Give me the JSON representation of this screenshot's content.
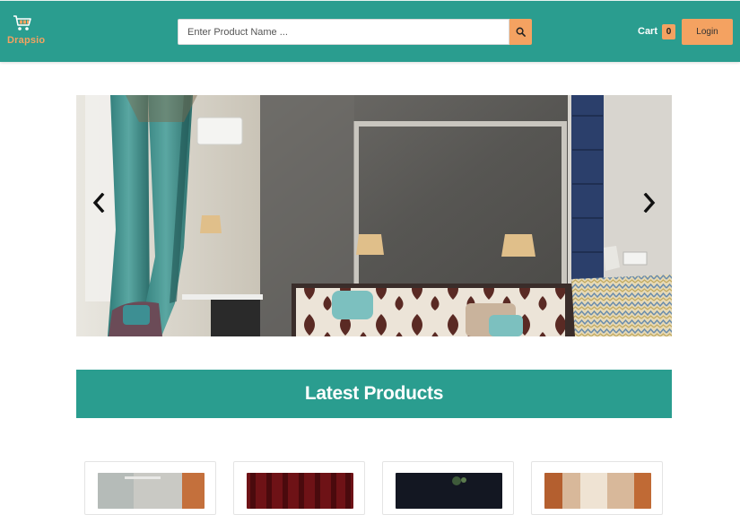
{
  "header": {
    "logo_text": "Drapsio",
    "logo_icon": "shopping-cart-icon",
    "search": {
      "placeholder": "Enter Product Name ...",
      "value": "",
      "button_icon": "search-icon"
    },
    "cart": {
      "label": "Cart",
      "count": "0"
    },
    "login_label": "Login"
  },
  "carousel": {
    "prev_icon": "chevron-left-icon",
    "next_icon": "chevron-right-icon",
    "slide_alt": "Bedroom with teal curtains, stone wall and patterned headboard"
  },
  "section": {
    "title": "Latest Products"
  },
  "products": [
    {
      "image_alt": "Room with orange curtain",
      "thumb_color": "#c9c9c4"
    },
    {
      "image_alt": "Red velvet curtain",
      "thumb_color": "#6e1216"
    },
    {
      "image_alt": "Dark night room",
      "thumb_color": "#131722"
    },
    {
      "image_alt": "Warm beige drapes",
      "thumb_color": "#d8b89a"
    }
  ],
  "colors": {
    "primary": "#2a9d8f",
    "accent": "#f4a261",
    "background": "#ffffff"
  }
}
